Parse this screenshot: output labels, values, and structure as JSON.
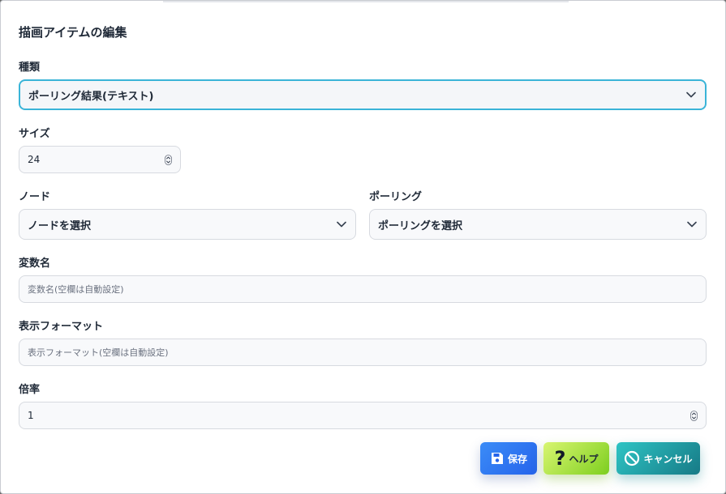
{
  "dialog": {
    "title": "描画アイテムの編集"
  },
  "fields": {
    "type": {
      "label": "種類",
      "value": "ポーリング結果(テキスト)"
    },
    "size": {
      "label": "サイズ",
      "value": "24"
    },
    "node": {
      "label": "ノード",
      "value": "ノードを選択"
    },
    "polling": {
      "label": "ポーリング",
      "value": "ポーリングを選択"
    },
    "variable": {
      "label": "変数名",
      "placeholder": "変数名(空欄は自動設定)"
    },
    "format": {
      "label": "表示フォーマット",
      "placeholder": "表示フォーマット(空欄は自動設定)"
    },
    "scale": {
      "label": "倍率",
      "value": "1"
    }
  },
  "buttons": {
    "save": {
      "label": "保存",
      "icon": "floppy-disk-icon",
      "color": "#2563eb"
    },
    "help": {
      "label": "ヘルプ",
      "icon": "question-mark-icon",
      "color": "#7ecf20"
    },
    "cancel": {
      "label": "キャンセル",
      "icon": "ban-icon",
      "color": "#177a86"
    }
  },
  "colors": {
    "focus_border": "#3ab4d8"
  }
}
